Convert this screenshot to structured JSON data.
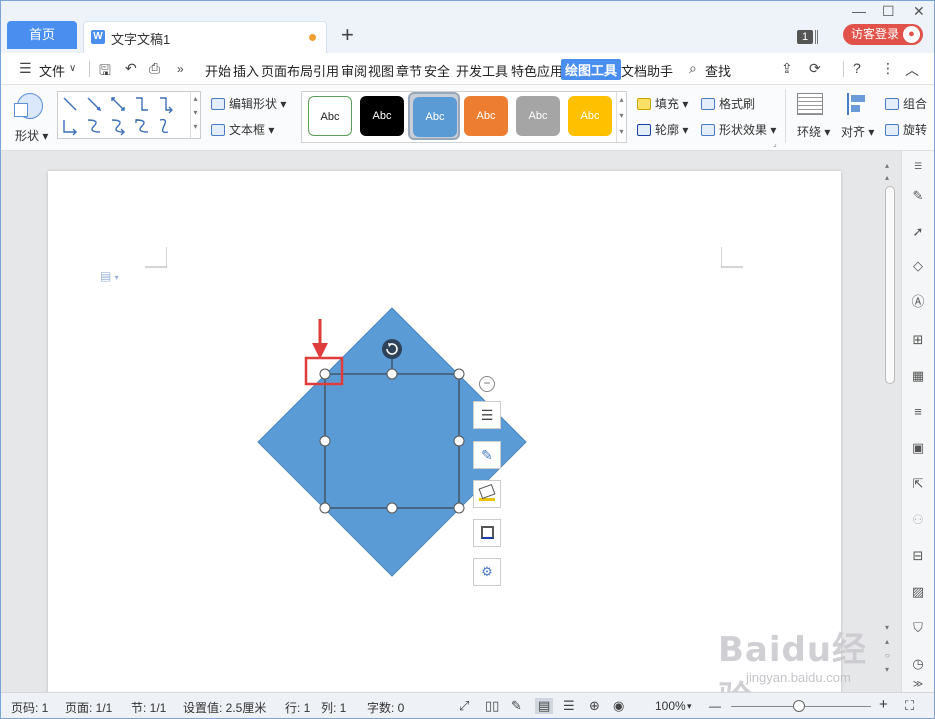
{
  "titlebar": {
    "home_tab": "首页",
    "doc_tab": "文字文稿1",
    "doc_tab_icon": "W",
    "add_tab": "+",
    "window_count": "1",
    "login_button": "访客登录",
    "min": "—",
    "max": "☐",
    "close": "✕"
  },
  "menubar": {
    "menu_label": "文件",
    "tabs": [
      "开始",
      "插入",
      "页面布局",
      "引用",
      "审阅",
      "视图",
      "章节",
      "安全",
      "开发工具",
      "特色应用",
      "绘图工具",
      "文档助手"
    ],
    "active_tab": "绘图工具",
    "search": "查找"
  },
  "ribbon": {
    "shape_label": "形状",
    "edit_shape": "编辑形状",
    "text_box": "文本框",
    "styles": [
      {
        "label": "Abc",
        "bg": "#ffffff",
        "fg": "#222222",
        "border": "#5aa05a"
      },
      {
        "label": "Abc",
        "bg": "#000000",
        "fg": "#ffffff",
        "border": "#000000"
      },
      {
        "label": "Abc",
        "bg": "#5b9bd5",
        "fg": "#ffffff",
        "border": "#4a86c0"
      },
      {
        "label": "Abc",
        "bg": "#ed7d31",
        "fg": "#ffffff",
        "border": "#d06a20"
      },
      {
        "label": "Abc",
        "bg": "#a5a5a5",
        "fg": "#ffffff",
        "border": "#909090"
      },
      {
        "label": "Abc",
        "bg": "#ffc000",
        "fg": "#ffffff",
        "border": "#e0a800"
      }
    ],
    "fill": "填充",
    "format_painter": "格式刷",
    "outline": "轮廓",
    "shape_effects": "形状效果",
    "wrap": "环绕",
    "align": "对齐",
    "group": "组合",
    "rotate": "旋转"
  },
  "canvas": {
    "diamond_color": "#5b9bd5",
    "highlight_color": "#e03c3c"
  },
  "statusbar": {
    "page_num": "页码: 1",
    "pages": "页面: 1/1",
    "section": "节: 1/1",
    "setting": "设置值: 2.5厘米",
    "row": "行: 1",
    "col": "列: 1",
    "words": "字数: 0",
    "zoom": "100%",
    "zoom_out": "—",
    "zoom_in": "+"
  },
  "watermark": {
    "brand": "Baidu经验",
    "url": "jingyan.baidu.com"
  }
}
